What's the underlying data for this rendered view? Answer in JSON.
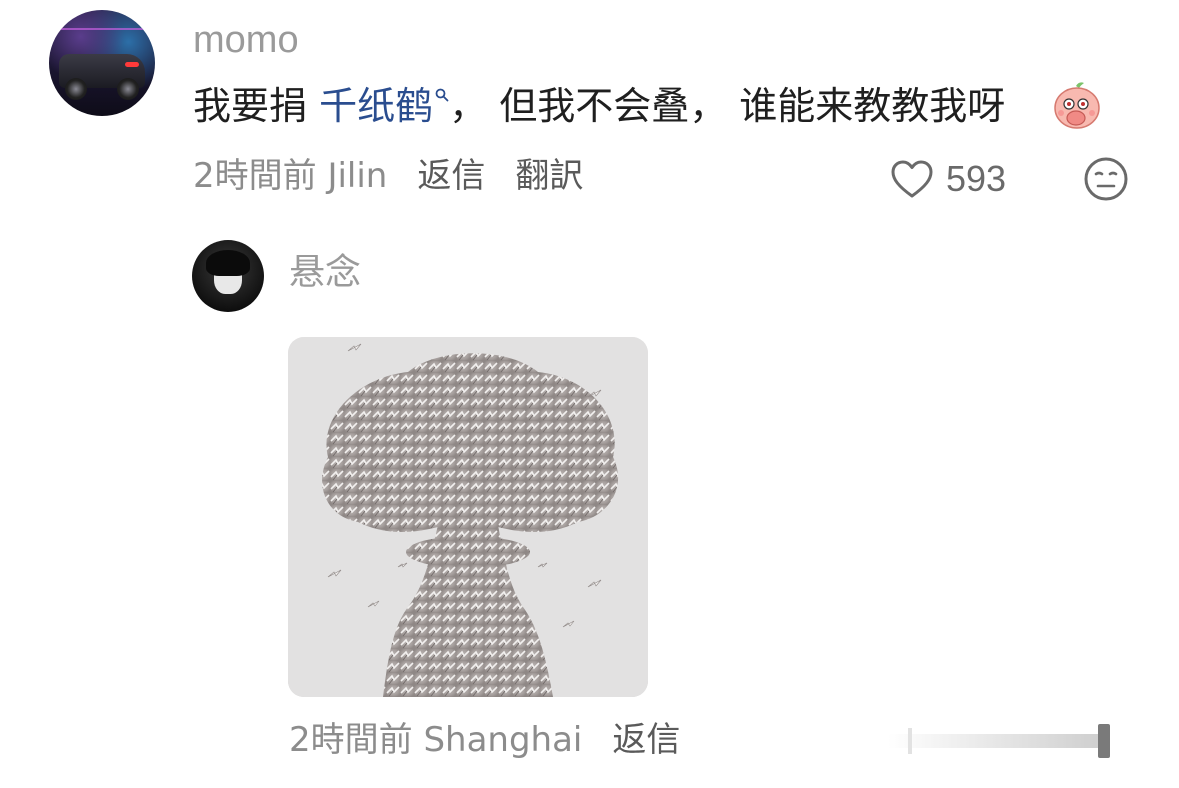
{
  "comment": {
    "username": "momo",
    "text_before": "我要捐 ",
    "link_text": "千纸鹤",
    "text_after": "，  但我不会叠，  谁能来教教我呀",
    "emoji": "pig-shy-emoji-icon",
    "time_location": "2時間前 Jilin",
    "reply_label": "返信",
    "translate_label": "翻訳",
    "like_count": "593"
  },
  "reply": {
    "username": "悬念",
    "time_location": "2時間前 Shanghai",
    "reply_label": "返信",
    "image": "paper-crane-mushroom-cloud-image"
  },
  "icons": {
    "search": "search-icon",
    "like": "heart-icon",
    "dislike": "neutral-face-icon"
  },
  "colors": {
    "link": "#2a4d8f",
    "meta": "#8c8c8c",
    "username": "#9a9a9a"
  }
}
